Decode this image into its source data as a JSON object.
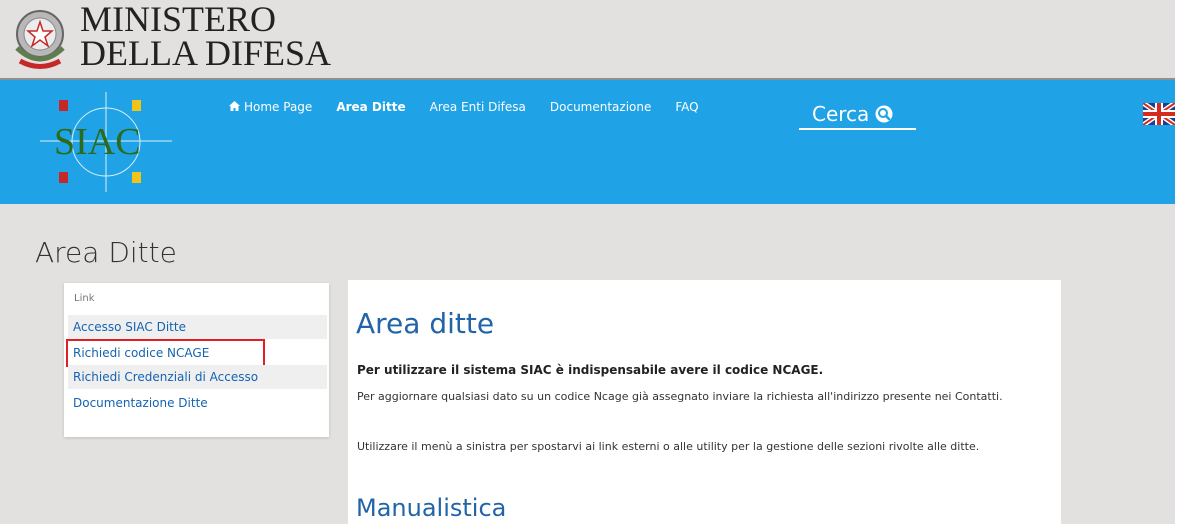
{
  "ministry": {
    "line1": "MINISTERO",
    "line2": "DELLA DIFESA"
  },
  "logo": {
    "text": "SIAC"
  },
  "nav": {
    "home": "Home Page",
    "area_ditte": "Area Ditte",
    "area_enti": "Area Enti Difesa",
    "documentazione": "Documentazione",
    "faq": "FAQ"
  },
  "search": {
    "label": "Cerca"
  },
  "page": {
    "title": "Area Ditte"
  },
  "sidebar": {
    "label": "Link",
    "items": [
      {
        "label": "Accesso SIAC Ditte"
      },
      {
        "label": "Richiedi codice NCAGE"
      },
      {
        "label": "Richiedi Credenziali di Accesso"
      },
      {
        "label": "Documentazione Ditte"
      }
    ]
  },
  "content": {
    "heading": "Area ditte",
    "intro": "Per utilizzare il sistema SIAC è indispensabile avere il codice NCAGE.",
    "para1": "Per aggiornare qualsiasi dato su un codice Ncage già assegnato inviare la richiesta all'indirizzo presente nei Contatti.",
    "para2": "Utilizzare il menù a sinistra per spostarvi ai link esterni o alle utility per la gestione delle sezioni rivolte alle ditte.",
    "subheading": "Manualistica"
  },
  "colors": {
    "nav_blue": "#1fa3e6",
    "link_blue": "#1463b1",
    "highlight_red": "#e21d24"
  },
  "icons": {
    "home": "home-icon",
    "search": "search-icon",
    "flag": "uk-flag-icon"
  }
}
